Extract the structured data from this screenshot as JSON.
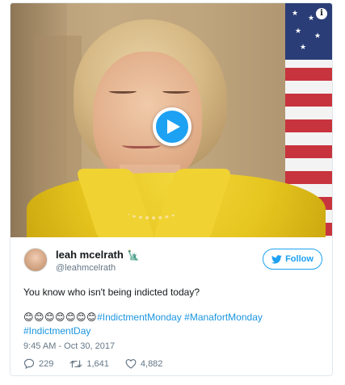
{
  "media": {
    "info_glyph": "i"
  },
  "user": {
    "display_name": "leah mcelrath",
    "name_emoji": "🗽",
    "handle": "@leahmcelrath"
  },
  "follow": {
    "label": "Follow"
  },
  "tweet": {
    "text": "You know who isn't being indicted today?",
    "emojis": "😊😊😊😊😊😊😊",
    "hashtags": [
      "#IndictmentMonday",
      "#ManafortMonday",
      "#IndictmentDay"
    ]
  },
  "timestamp": "9:45 AM - Oct 30, 2017",
  "actions": {
    "replies": "229",
    "retweets": "1,641",
    "likes": "4,882"
  },
  "colors": {
    "accent": "#1da1f2",
    "link": "#1b95e0",
    "muted": "#657786"
  },
  "icons": [
    "play-icon",
    "info-icon",
    "twitter-bird-icon",
    "reply-icon",
    "retweet-icon",
    "heart-icon"
  ]
}
